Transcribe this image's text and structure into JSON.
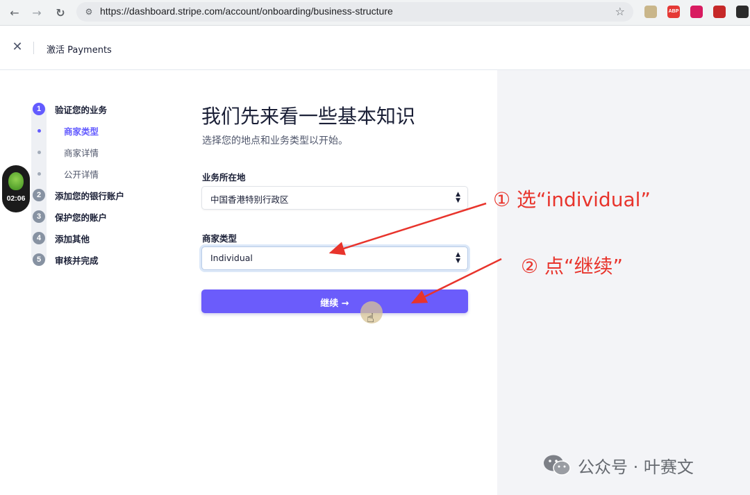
{
  "browser": {
    "url": "https://dashboard.stripe.com/account/onboarding/business-structure",
    "back_icon": "←",
    "forward_icon": "→",
    "reload_icon": "↻",
    "star_icon": "☆",
    "extensions": [
      {
        "name": "image-ext-icon",
        "label": "",
        "color": "#c9b68a"
      },
      {
        "name": "adblock-icon",
        "label": "ABP",
        "color": "#e53935"
      },
      {
        "name": "translate-ext-icon",
        "label": "",
        "color": "#d81b60"
      },
      {
        "name": "red-ext-icon",
        "label": "",
        "color": "#c62828"
      },
      {
        "name": "profile-ext-icon",
        "label": "",
        "color": "#2b2b2b"
      }
    ]
  },
  "header": {
    "close_icon": "✕",
    "title": "激活 Payments"
  },
  "timer": {
    "time": "02:06"
  },
  "steps": [
    {
      "num": "1",
      "label": "验证您的业务",
      "state": "active"
    },
    {
      "num": "2",
      "label": "添加您的银行账户",
      "state": "pending"
    },
    {
      "num": "3",
      "label": "保护您的账户",
      "state": "pending"
    },
    {
      "num": "4",
      "label": "添加其他",
      "state": "pending"
    },
    {
      "num": "5",
      "label": "审核并完成",
      "state": "pending"
    }
  ],
  "substeps": [
    {
      "label": "商家类型",
      "state": "current"
    },
    {
      "label": "商家详情",
      "state": "pending"
    },
    {
      "label": "公开详情",
      "state": "pending"
    }
  ],
  "form": {
    "title": "我们先来看一些基本知识",
    "subtitle": "选择您的地点和业务类型以开始。",
    "location_label": "业务所在地",
    "location_value": "中国香港特别行政区",
    "type_label": "商家类型",
    "type_value": "Individual",
    "continue_label": "继续 →"
  },
  "annotations": {
    "step1": "① 选“individual”",
    "step2": "② 点“继续”",
    "color": "#e8342c"
  },
  "watermark": {
    "text": "公众号 · 叶赛文"
  },
  "colors": {
    "accent": "#635bff",
    "button": "#6b5cfb",
    "right_panel": "#f3f4f7"
  }
}
